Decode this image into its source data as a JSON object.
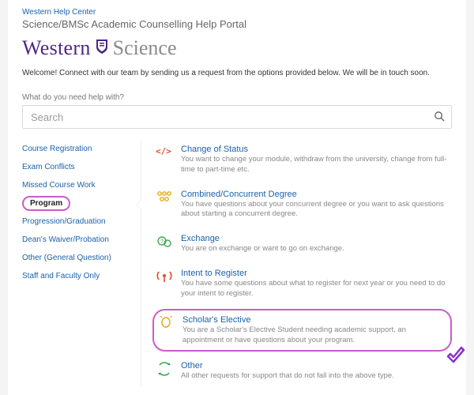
{
  "breadcrumb": "Western Help Center",
  "portal_title": "Science/BMSc Academic Counselling Help Portal",
  "logo": {
    "word_western": "Western",
    "word_science": "Science"
  },
  "welcome": "Welcome! Connect with our team by sending us a request from the options provided below. We will be in touch soon.",
  "search": {
    "prompt": "What do you need help with?",
    "placeholder": "Search"
  },
  "sidebar": {
    "items": [
      {
        "label": "Course Registration"
      },
      {
        "label": "Exam Conflicts"
      },
      {
        "label": "Missed Course Work"
      },
      {
        "label": "Program"
      },
      {
        "label": "Progression/Graduation"
      },
      {
        "label": "Dean's Waiver/Probation"
      },
      {
        "label": "Other (General Question)"
      },
      {
        "label": "Staff and Faculty Only"
      }
    ]
  },
  "options": [
    {
      "title": "Change of Status",
      "desc": "You want to change your module, withdraw from the university, change from full-time to part-time etc."
    },
    {
      "title": "Combined/Concurrent Degree",
      "desc": "You have questions about your concurrent degree or you want to ask questions about starting a concurrent degree."
    },
    {
      "title": "Exchange",
      "desc": "You are on exchange or want to go on exchange."
    },
    {
      "title": "Intent to Register",
      "desc": "You have some questions about what to register for next year or you need to do your intent to register."
    },
    {
      "title": "Scholar's Elective",
      "desc": "You are a Scholar's Elective Student needing academic support, an appointment or have questions about your program."
    },
    {
      "title": "Other",
      "desc": "All other requests for support that do not fall into the above type."
    }
  ]
}
